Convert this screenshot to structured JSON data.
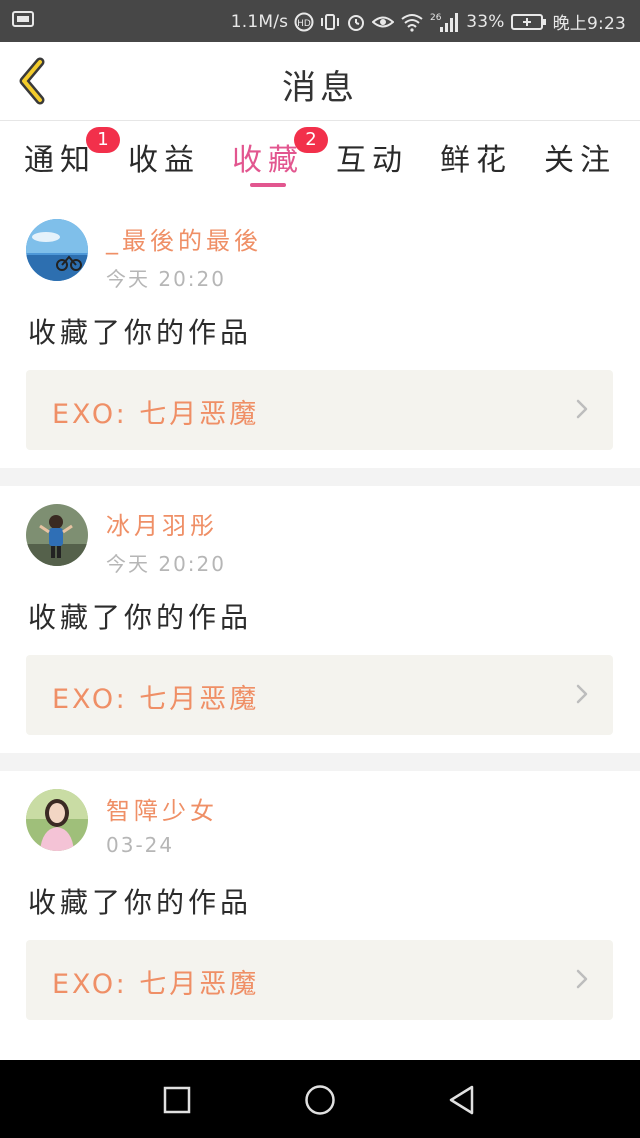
{
  "status_bar": {
    "speed": "1.1M/s",
    "network": "26",
    "battery": "33%",
    "time": "晚上9:23"
  },
  "header": {
    "title": "消息",
    "back_icon": "chevron-left-icon"
  },
  "tabs": [
    {
      "label": "通知",
      "badge": "1"
    },
    {
      "label": "收益",
      "badge": ""
    },
    {
      "label": "收藏",
      "badge": "2",
      "active": true
    },
    {
      "label": "互动",
      "badge": ""
    },
    {
      "label": "鲜花",
      "badge": ""
    },
    {
      "label": "关注",
      "badge": ""
    }
  ],
  "messages": [
    {
      "username": "_最後的最後",
      "time": "今天  20:20",
      "action": "收藏了你的作品",
      "work_title": "EXO:  七月恶魔"
    },
    {
      "username": "冰月羽彤",
      "time": "今天  20:20",
      "action": "收藏了你的作品",
      "work_title": "EXO:  七月恶魔"
    },
    {
      "username": "智障少女",
      "time": "03-24",
      "action": "收藏了你的作品",
      "work_title": "EXO:  七月恶魔"
    }
  ],
  "colors": {
    "accent": "#e2568f",
    "name": "#ef8f66",
    "badge": "#f2304b",
    "work_box": "#f4f3ee"
  },
  "nav": {
    "recent_icon": "square-icon",
    "home_icon": "circle-icon",
    "back_icon": "triangle-back-icon"
  }
}
